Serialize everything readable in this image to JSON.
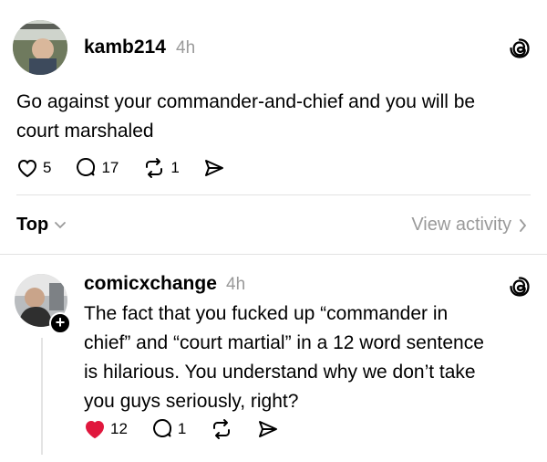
{
  "post": {
    "username": "kamb214",
    "time": "4h",
    "text_line1": "Go against your commander-and-chief and you will be",
    "text_line2": "court marshaled",
    "likes": "5",
    "replies": "17",
    "reposts": "1",
    "avatar_icon": "user-photo-avatar",
    "threads_icon": "threads-logo-icon"
  },
  "filter": {
    "sort_label": "Top",
    "view_activity_label": "View activity"
  },
  "reply": {
    "username": "comicxchange",
    "time": "4h",
    "lines": [
      "The fact that you fucked up “commander in",
      "chief” and “court martial” in a 12 word sentence",
      "is hilarious. You understand why we don’t take",
      "you guys seriously, right?"
    ],
    "likes": "12",
    "replies": "1",
    "liked": true,
    "like_color": "#e0173d",
    "follow_badge": "+"
  }
}
